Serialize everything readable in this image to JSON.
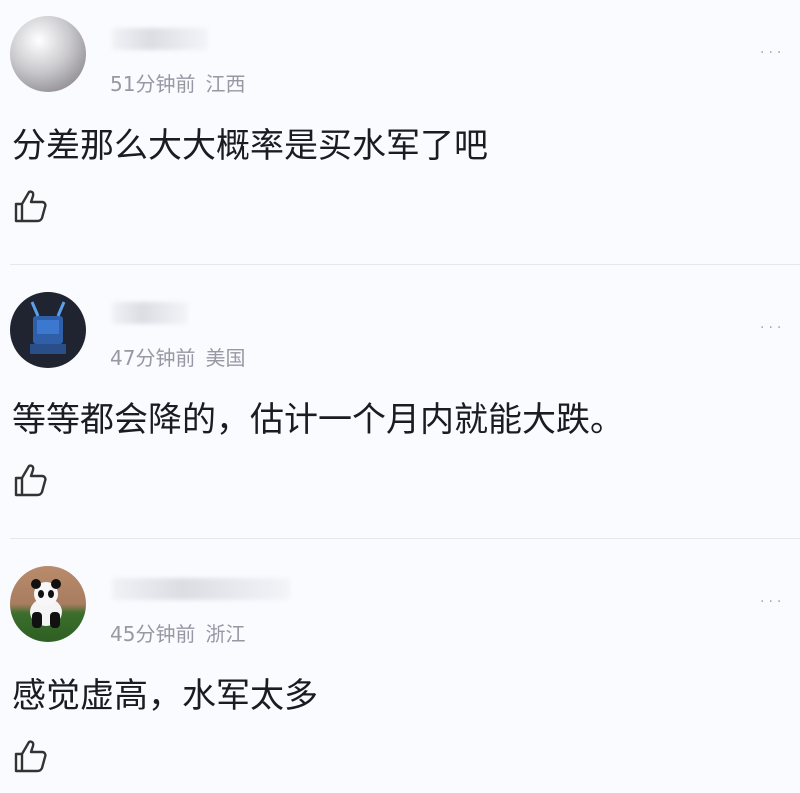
{
  "comments": [
    {
      "time": "51分钟前",
      "location": "江西",
      "text": "分差那么大大概率是买水军了吧",
      "avatar": "pearl-avatar"
    },
    {
      "time": "47分钟前",
      "location": "美国",
      "text": "等等都会降的，估计一个月内就能大跌。",
      "avatar": "robot-avatar"
    },
    {
      "time": "45分钟前",
      "location": "浙江",
      "text": "感觉虚高，水军太多",
      "avatar": "panda-avatar"
    }
  ],
  "more_label": "···",
  "icons": {
    "like": "thumbs-up-icon",
    "more": "more-dots-icon"
  },
  "colors": {
    "background": "#fafbff",
    "meta": "#9698a3",
    "text": "#1b1c22"
  }
}
